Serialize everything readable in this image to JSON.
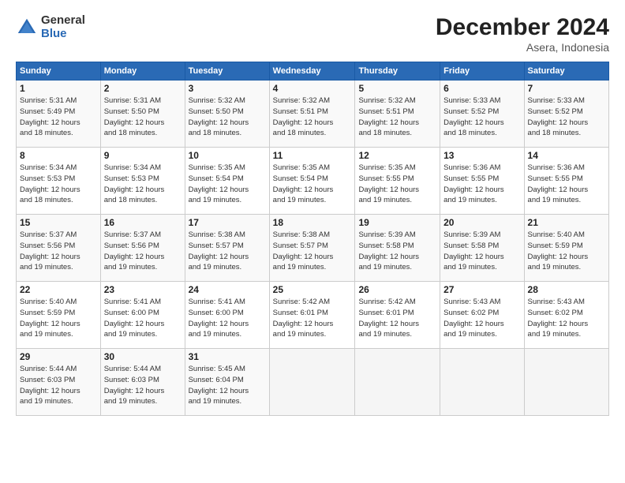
{
  "logo": {
    "general": "General",
    "blue": "Blue"
  },
  "title": "December 2024",
  "subtitle": "Asera, Indonesia",
  "weekdays": [
    "Sunday",
    "Monday",
    "Tuesday",
    "Wednesday",
    "Thursday",
    "Friday",
    "Saturday"
  ],
  "weeks": [
    [
      {
        "day": "1",
        "info": "Sunrise: 5:31 AM\nSunset: 5:49 PM\nDaylight: 12 hours\nand 18 minutes."
      },
      {
        "day": "2",
        "info": "Sunrise: 5:31 AM\nSunset: 5:50 PM\nDaylight: 12 hours\nand 18 minutes."
      },
      {
        "day": "3",
        "info": "Sunrise: 5:32 AM\nSunset: 5:50 PM\nDaylight: 12 hours\nand 18 minutes."
      },
      {
        "day": "4",
        "info": "Sunrise: 5:32 AM\nSunset: 5:51 PM\nDaylight: 12 hours\nand 18 minutes."
      },
      {
        "day": "5",
        "info": "Sunrise: 5:32 AM\nSunset: 5:51 PM\nDaylight: 12 hours\nand 18 minutes."
      },
      {
        "day": "6",
        "info": "Sunrise: 5:33 AM\nSunset: 5:52 PM\nDaylight: 12 hours\nand 18 minutes."
      },
      {
        "day": "7",
        "info": "Sunrise: 5:33 AM\nSunset: 5:52 PM\nDaylight: 12 hours\nand 18 minutes."
      }
    ],
    [
      {
        "day": "8",
        "info": "Sunrise: 5:34 AM\nSunset: 5:53 PM\nDaylight: 12 hours\nand 18 minutes."
      },
      {
        "day": "9",
        "info": "Sunrise: 5:34 AM\nSunset: 5:53 PM\nDaylight: 12 hours\nand 18 minutes."
      },
      {
        "day": "10",
        "info": "Sunrise: 5:35 AM\nSunset: 5:54 PM\nDaylight: 12 hours\nand 19 minutes."
      },
      {
        "day": "11",
        "info": "Sunrise: 5:35 AM\nSunset: 5:54 PM\nDaylight: 12 hours\nand 19 minutes."
      },
      {
        "day": "12",
        "info": "Sunrise: 5:35 AM\nSunset: 5:55 PM\nDaylight: 12 hours\nand 19 minutes."
      },
      {
        "day": "13",
        "info": "Sunrise: 5:36 AM\nSunset: 5:55 PM\nDaylight: 12 hours\nand 19 minutes."
      },
      {
        "day": "14",
        "info": "Sunrise: 5:36 AM\nSunset: 5:55 PM\nDaylight: 12 hours\nand 19 minutes."
      }
    ],
    [
      {
        "day": "15",
        "info": "Sunrise: 5:37 AM\nSunset: 5:56 PM\nDaylight: 12 hours\nand 19 minutes."
      },
      {
        "day": "16",
        "info": "Sunrise: 5:37 AM\nSunset: 5:56 PM\nDaylight: 12 hours\nand 19 minutes."
      },
      {
        "day": "17",
        "info": "Sunrise: 5:38 AM\nSunset: 5:57 PM\nDaylight: 12 hours\nand 19 minutes."
      },
      {
        "day": "18",
        "info": "Sunrise: 5:38 AM\nSunset: 5:57 PM\nDaylight: 12 hours\nand 19 minutes."
      },
      {
        "day": "19",
        "info": "Sunrise: 5:39 AM\nSunset: 5:58 PM\nDaylight: 12 hours\nand 19 minutes."
      },
      {
        "day": "20",
        "info": "Sunrise: 5:39 AM\nSunset: 5:58 PM\nDaylight: 12 hours\nand 19 minutes."
      },
      {
        "day": "21",
        "info": "Sunrise: 5:40 AM\nSunset: 5:59 PM\nDaylight: 12 hours\nand 19 minutes."
      }
    ],
    [
      {
        "day": "22",
        "info": "Sunrise: 5:40 AM\nSunset: 5:59 PM\nDaylight: 12 hours\nand 19 minutes."
      },
      {
        "day": "23",
        "info": "Sunrise: 5:41 AM\nSunset: 6:00 PM\nDaylight: 12 hours\nand 19 minutes."
      },
      {
        "day": "24",
        "info": "Sunrise: 5:41 AM\nSunset: 6:00 PM\nDaylight: 12 hours\nand 19 minutes."
      },
      {
        "day": "25",
        "info": "Sunrise: 5:42 AM\nSunset: 6:01 PM\nDaylight: 12 hours\nand 19 minutes."
      },
      {
        "day": "26",
        "info": "Sunrise: 5:42 AM\nSunset: 6:01 PM\nDaylight: 12 hours\nand 19 minutes."
      },
      {
        "day": "27",
        "info": "Sunrise: 5:43 AM\nSunset: 6:02 PM\nDaylight: 12 hours\nand 19 minutes."
      },
      {
        "day": "28",
        "info": "Sunrise: 5:43 AM\nSunset: 6:02 PM\nDaylight: 12 hours\nand 19 minutes."
      }
    ],
    [
      {
        "day": "29",
        "info": "Sunrise: 5:44 AM\nSunset: 6:03 PM\nDaylight: 12 hours\nand 19 minutes."
      },
      {
        "day": "30",
        "info": "Sunrise: 5:44 AM\nSunset: 6:03 PM\nDaylight: 12 hours\nand 19 minutes."
      },
      {
        "day": "31",
        "info": "Sunrise: 5:45 AM\nSunset: 6:04 PM\nDaylight: 12 hours\nand 19 minutes."
      },
      {
        "day": "",
        "info": ""
      },
      {
        "day": "",
        "info": ""
      },
      {
        "day": "",
        "info": ""
      },
      {
        "day": "",
        "info": ""
      }
    ]
  ]
}
